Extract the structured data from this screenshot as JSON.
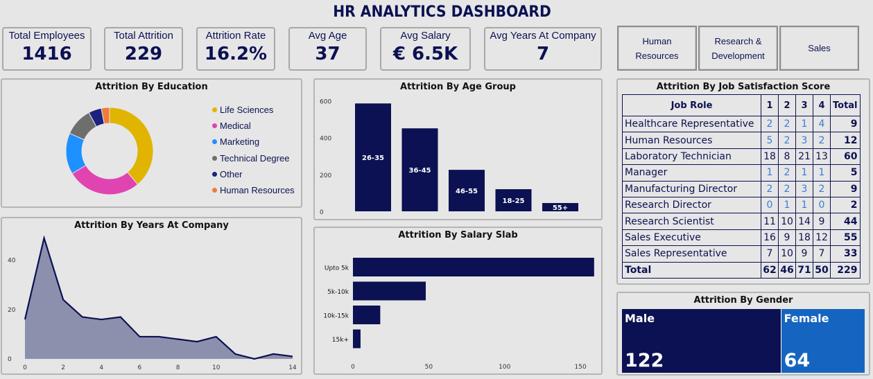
{
  "title": "HR ANALYTICS DASHBOARD",
  "kpis": [
    {
      "label": "Total Employees",
      "value": "1416"
    },
    {
      "label": "Total Attrition",
      "value": "229"
    },
    {
      "label": "Attrition Rate",
      "value": "16.2%"
    },
    {
      "label": "Avg Age",
      "value": "37"
    },
    {
      "label": "Avg Salary",
      "value": "€ 6.5K"
    },
    {
      "label": "Avg Years At Company",
      "value": "7"
    }
  ],
  "slicers": [
    "Human Resources",
    "Research & Development",
    "Sales"
  ],
  "colors": {
    "navy": "#0b1152",
    "female_blue": "#1565c0",
    "area_fill": "#8c90ad"
  },
  "chart_data": [
    {
      "id": "education",
      "type": "pie",
      "title": "Attrition By Education",
      "labels": [
        "Life Sciences",
        "Medical",
        "Marketing",
        "Technical Degree",
        "Other",
        "Human Resources"
      ],
      "values": [
        89,
        63,
        35,
        24,
        11,
        7
      ],
      "colors": [
        "#e0b400",
        "#e044b0",
        "#1e90ff",
        "#6e6e6e",
        "#1a237e",
        "#f07a3c"
      ]
    },
    {
      "id": "age_group",
      "type": "bar",
      "title": "Attrition By Age Group",
      "categories": [
        "26-35",
        "36-45",
        "46-55",
        "18-25",
        "55+"
      ],
      "values": [
        585,
        450,
        225,
        120,
        45
      ],
      "yticks": [
        0,
        200,
        400,
        600
      ],
      "ylim": [
        0,
        650
      ]
    },
    {
      "id": "years_at_company",
      "type": "area",
      "title": "Attrition By Years At Company",
      "x": [
        0,
        1,
        2,
        3,
        4,
        5,
        6,
        7,
        8,
        9,
        10,
        11,
        12,
        13,
        14
      ],
      "values": [
        16,
        49,
        24,
        17,
        16,
        17,
        9,
        9,
        8,
        7,
        9,
        2,
        0,
        2,
        1
      ],
      "xticks": [
        0,
        2,
        4,
        6,
        8,
        10,
        14
      ],
      "yticks": [
        0,
        20,
        40
      ],
      "ylim": [
        0,
        50
      ]
    },
    {
      "id": "salary_slab",
      "type": "bar",
      "orientation": "horizontal",
      "title": "Attrition By Salary Slab",
      "categories": [
        "Upto 5k",
        "5k-10k",
        "10k-15k",
        "15k+"
      ],
      "values": [
        159,
        48,
        18,
        5
      ],
      "xticks": [
        0,
        50,
        100,
        150
      ],
      "xlim": [
        0,
        160
      ]
    },
    {
      "id": "job_satisfaction",
      "type": "table",
      "title": "Attrition By Job Satisfaction Score",
      "columns": [
        "Job Role",
        "1",
        "2",
        "3",
        "4",
        "Total"
      ],
      "rows": [
        [
          "Healthcare Representative",
          "2",
          "2",
          "1",
          "4",
          "9"
        ],
        [
          "Human Resources",
          "5",
          "2",
          "3",
          "2",
          "12"
        ],
        [
          "Laboratory Technician",
          "18",
          "8",
          "21",
          "13",
          "60"
        ],
        [
          "Manager",
          "1",
          "2",
          "1",
          "1",
          "5"
        ],
        [
          "Manufacturing Director",
          "2",
          "2",
          "3",
          "2",
          "9"
        ],
        [
          "Research Director",
          "0",
          "1",
          "1",
          "0",
          "2"
        ],
        [
          "Research Scientist",
          "11",
          "10",
          "14",
          "9",
          "44"
        ],
        [
          "Sales Executive",
          "16",
          "9",
          "18",
          "12",
          "55"
        ],
        [
          "Sales Representative",
          "7",
          "10",
          "9",
          "7",
          "33"
        ]
      ],
      "total": [
        "Total",
        "62",
        "46",
        "71",
        "50",
        "229"
      ]
    },
    {
      "id": "gender",
      "type": "bar",
      "title": "Attrition By Gender",
      "categories": [
        "Male",
        "Female"
      ],
      "values": [
        122,
        64
      ],
      "value_labels": [
        "122",
        "64"
      ],
      "colors": [
        "#0b1152",
        "#1565c0"
      ]
    }
  ]
}
